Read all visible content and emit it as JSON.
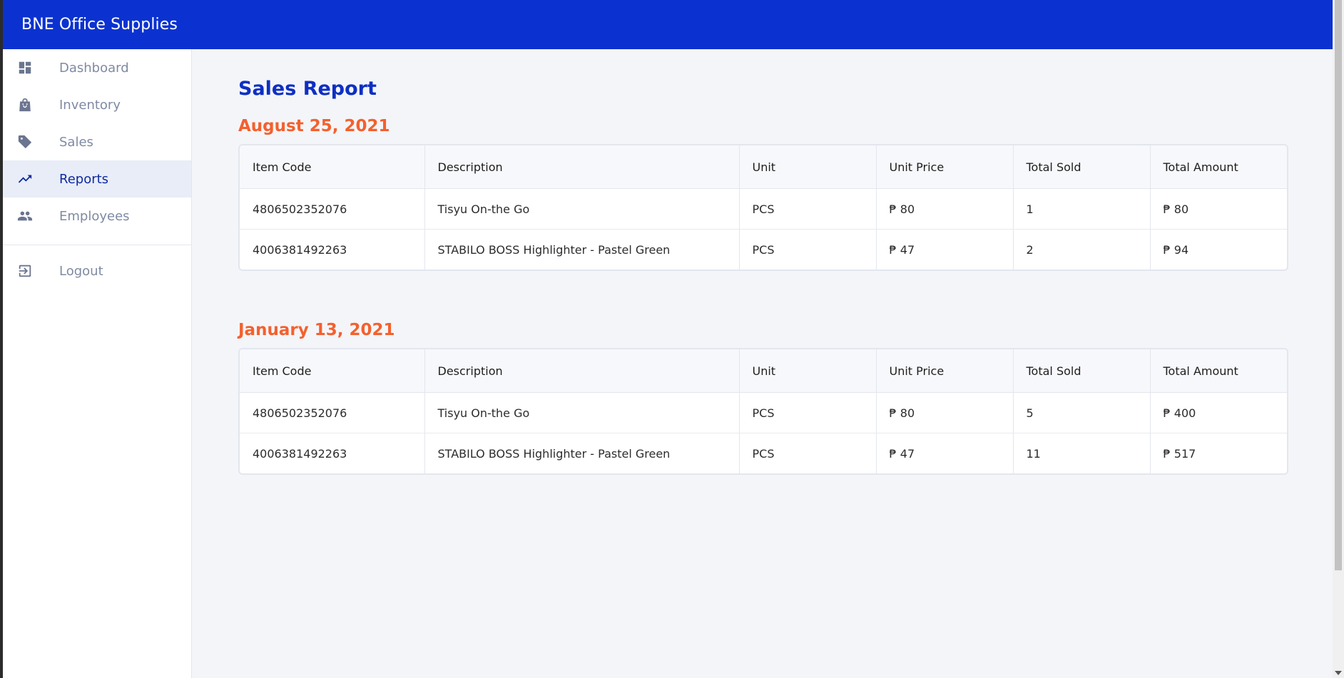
{
  "app": {
    "brand": "BNE Office Supplies"
  },
  "sidebar": {
    "items": [
      {
        "label": "Dashboard",
        "icon": "dashboard-icon"
      },
      {
        "label": "Inventory",
        "icon": "shopping-bag-icon"
      },
      {
        "label": "Sales",
        "icon": "tag-icon"
      },
      {
        "label": "Reports",
        "icon": "trending-up-icon",
        "active": true
      },
      {
        "label": "Employees",
        "icon": "people-icon"
      }
    ],
    "logout": {
      "label": "Logout",
      "icon": "logout-icon"
    }
  },
  "main": {
    "title": "Sales Report",
    "columns": [
      "Item Code",
      "Description",
      "Unit",
      "Unit Price",
      "Total Sold",
      "Total Amount"
    ],
    "reports": [
      {
        "date": "August 25, 2021",
        "rows": [
          [
            "4806502352076",
            "Tisyu On-the Go",
            "PCS",
            "₱ 80",
            "1",
            "₱ 80"
          ],
          [
            "4006381492263",
            "STABILO BOSS Highlighter - Pastel Green",
            "PCS",
            "₱ 47",
            "2",
            "₱ 94"
          ]
        ]
      },
      {
        "date": "January 13, 2021",
        "rows": [
          [
            "4806502352076",
            "Tisyu On-the Go",
            "PCS",
            "₱ 80",
            "5",
            "₱ 400"
          ],
          [
            "4006381492263",
            "STABILO BOSS Highlighter - Pastel Green",
            "PCS",
            "₱ 47",
            "11",
            "₱ 517"
          ]
        ]
      }
    ]
  },
  "colors": {
    "header_bg": "#0b32d0",
    "title": "#0e2fc4",
    "date_accent": "#f4602e",
    "nav_active_bg": "#e8edf7"
  }
}
